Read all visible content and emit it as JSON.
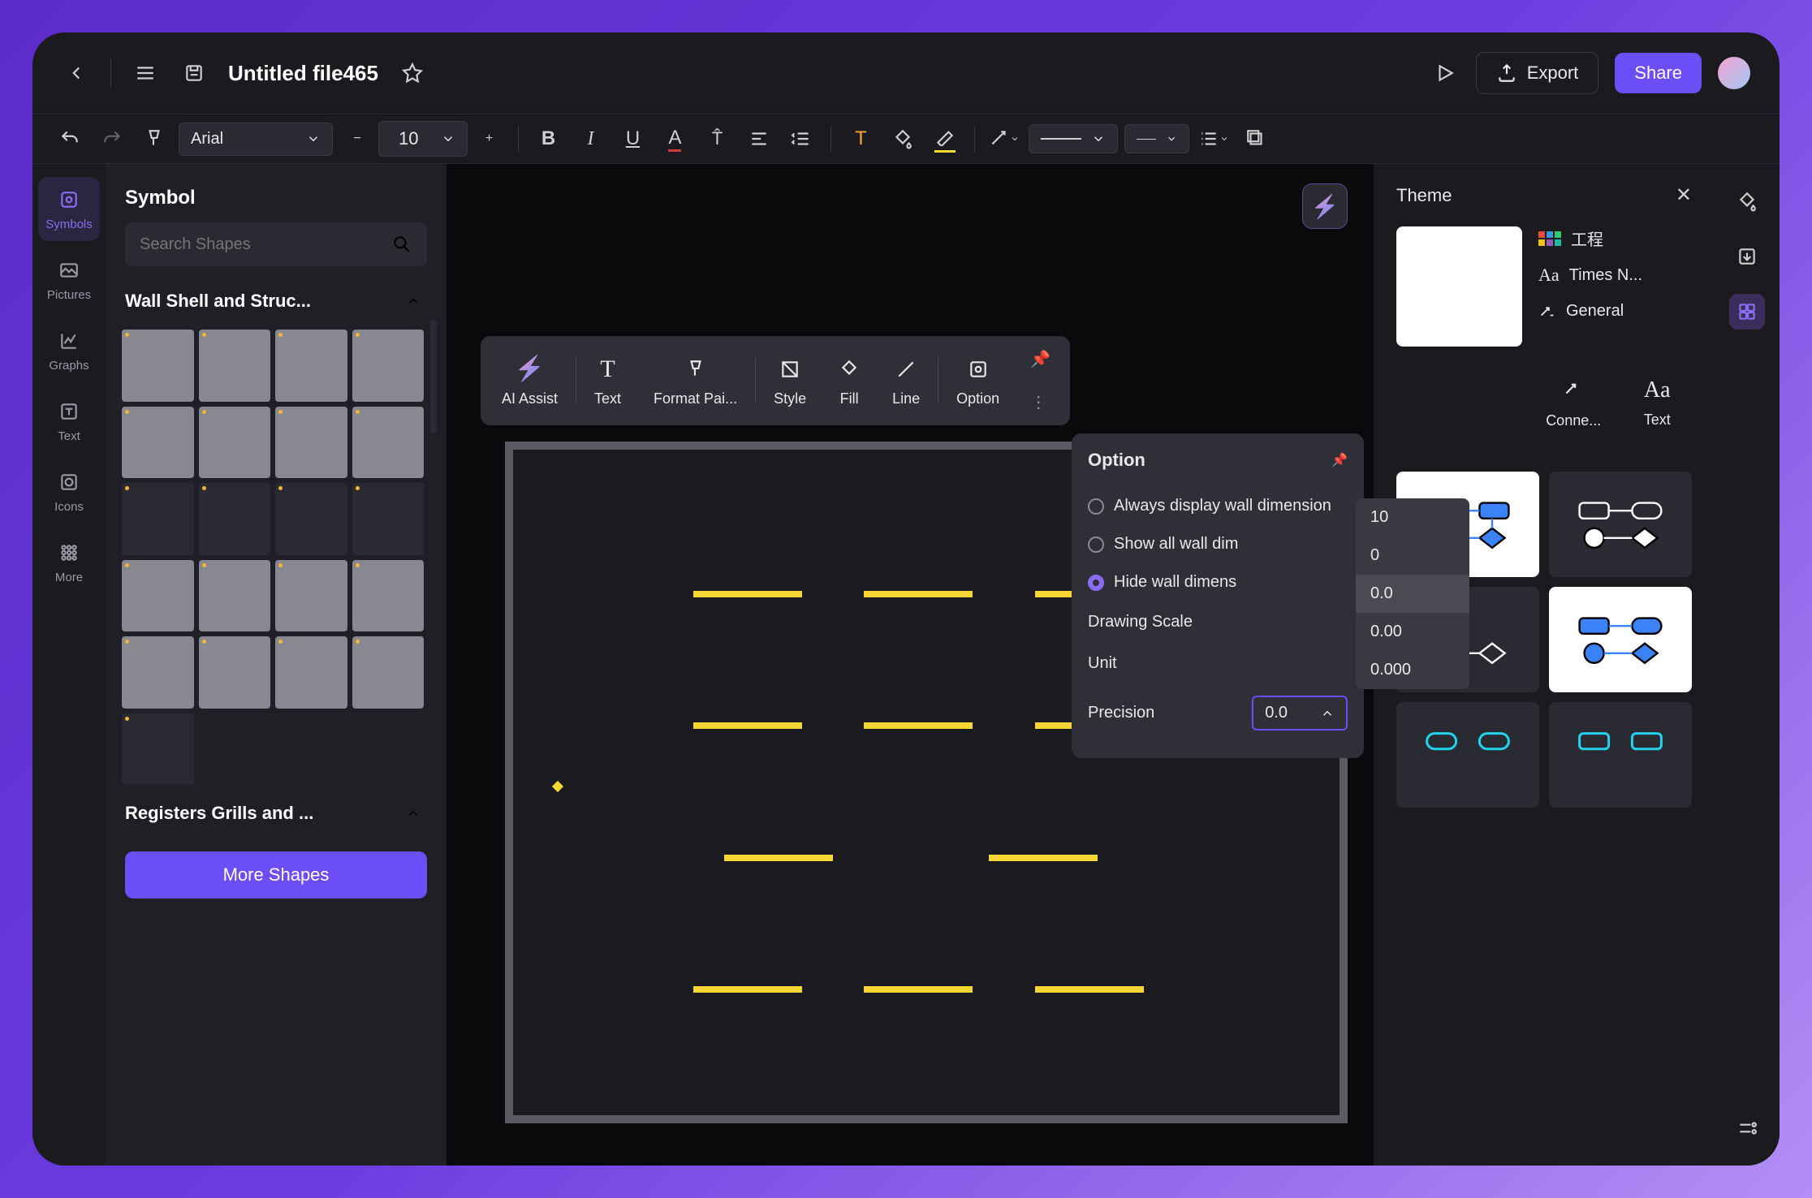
{
  "titlebar": {
    "title": "Untitled file465",
    "export": "Export",
    "share": "Share"
  },
  "toolbar": {
    "font": "Arial",
    "size": "10"
  },
  "rail": {
    "items": [
      {
        "label": "Symbols",
        "active": true
      },
      {
        "label": "Pictures",
        "active": false
      },
      {
        "label": "Graphs",
        "active": false
      },
      {
        "label": "Text",
        "active": false
      },
      {
        "label": "Icons",
        "active": false
      },
      {
        "label": "More",
        "active": false
      }
    ]
  },
  "symbol_panel": {
    "title": "Symbol",
    "search_placeholder": "Search Shapes",
    "category1": "Wall Shell and Struc...",
    "category2": "Registers Grills and ...",
    "more_btn": "More Shapes"
  },
  "float_toolbar": {
    "items": [
      "AI Assist",
      "Text",
      "Format Pai...",
      "Style",
      "Fill",
      "Line",
      "Option"
    ]
  },
  "option_popup": {
    "title": "Option",
    "opt1": "Always display wall dimension",
    "opt2": "Show all wall dim",
    "opt3": "Hide wall dimens",
    "drawing_scale": "Drawing Scale",
    "unit": "Unit",
    "precision": "Precision",
    "precision_value": "0.0"
  },
  "precision_dropdown": {
    "items": [
      "10",
      "0",
      "0.0",
      "0.00",
      "0.000"
    ],
    "selected": "0.0"
  },
  "theme_panel": {
    "title": "Theme",
    "name": "工程",
    "font": "Times N...",
    "connector": "General",
    "icon_row": [
      {
        "label": "Conne..."
      },
      {
        "label": "Text"
      }
    ]
  }
}
